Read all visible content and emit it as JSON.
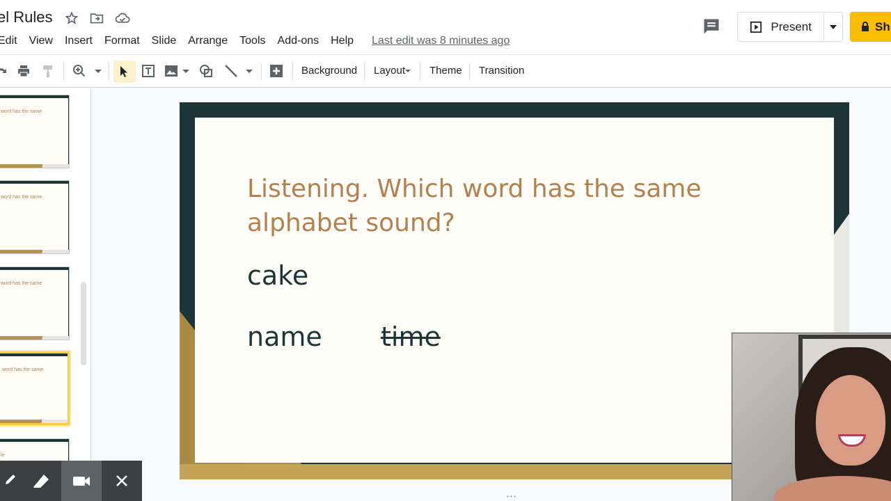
{
  "app": {
    "doc_title": "el Rules",
    "last_edit": "Last edit was 8 minutes ago"
  },
  "menu": [
    "Edit",
    "View",
    "Insert",
    "Format",
    "Slide",
    "Arrange",
    "Tools",
    "Add-ons",
    "Help"
  ],
  "header": {
    "present_label": "Present",
    "share_label": "Sh"
  },
  "toolbar": {
    "background_label": "Background",
    "layout_label": "Layout",
    "theme_label": "Theme",
    "transition_label": "Transition"
  },
  "filmstrip": {
    "thumbs": [
      {
        "text": "word has the same"
      },
      {
        "text": "word has the same"
      },
      {
        "text": "word has the same"
      },
      {
        "text": "word has the same",
        "selected": true
      },
      {
        "text": "le"
      }
    ]
  },
  "slide": {
    "title": "Listening. Which word has the same alphabet sound?",
    "words": {
      "cake": "cake",
      "name": "name",
      "time": "time"
    },
    "colors": {
      "dark": "#1e3538",
      "gold": "#c3a457",
      "title": "#b4804f",
      "paper": "#fffef9"
    }
  },
  "overlay": {
    "icons": [
      "pen-icon",
      "eraser-icon",
      "camera-icon",
      "close-icon"
    ]
  }
}
